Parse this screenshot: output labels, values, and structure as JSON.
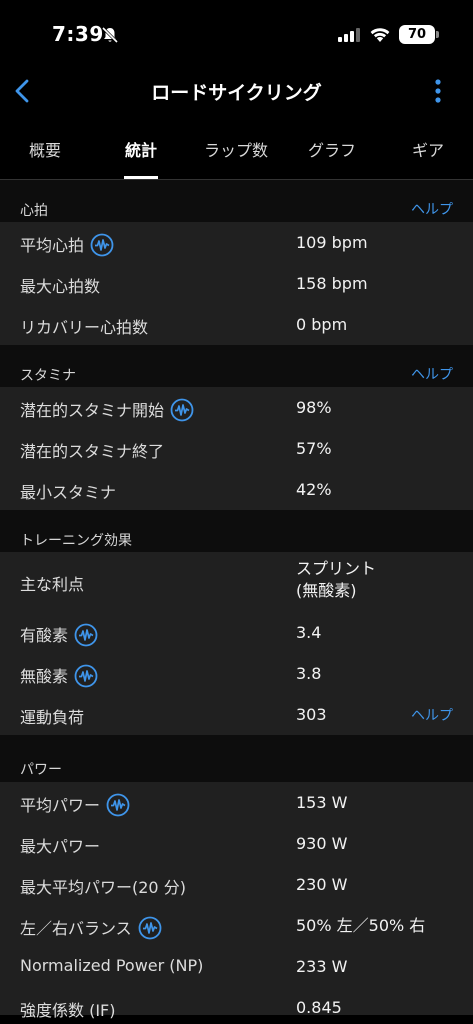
{
  "status": {
    "time": "7:39",
    "battery": "70"
  },
  "nav": {
    "title": "ロードサイクリング"
  },
  "tabs": [
    "概要",
    "統計",
    "ラップ数",
    "グラフ",
    "ギア"
  ],
  "help_label": "ヘルプ",
  "sections": {
    "heart": {
      "title": "心拍",
      "rows": [
        {
          "label": "平均心拍",
          "value": "109 bpm"
        },
        {
          "label": "最大心拍数",
          "value": "158 bpm"
        },
        {
          "label": "リカバリー心拍数",
          "value": "0 bpm"
        }
      ]
    },
    "stamina": {
      "title": "スタミナ",
      "rows": [
        {
          "label": "潜在的スタミナ開始",
          "value": "98%"
        },
        {
          "label": "潜在的スタミナ終了",
          "value": "57%"
        },
        {
          "label": "最小スタミナ",
          "value": "42%"
        }
      ]
    },
    "training": {
      "title": "トレーニング効果",
      "rows": [
        {
          "label": "主な利点",
          "value_line1": "スプリント",
          "value_line2": "(無酸素)"
        },
        {
          "label": "有酸素",
          "value": "3.4"
        },
        {
          "label": "無酸素",
          "value": "3.8"
        },
        {
          "label": "運動負荷",
          "value": "303"
        }
      ]
    },
    "power": {
      "title": "パワー",
      "rows": [
        {
          "label": "平均パワー",
          "value": "153 W"
        },
        {
          "label": "最大パワー",
          "value": "930 W"
        },
        {
          "label": "最大平均パワー(20 分)",
          "value": "230 W"
        },
        {
          "label": "左／右バランス",
          "value": "50% 左／50% 右"
        },
        {
          "label": "Normalized Power (NP)",
          "value": "233 W"
        },
        {
          "label": "強度係数 (IF)",
          "value": "0.845"
        }
      ]
    }
  },
  "colors": {
    "accent": "#3f95ea",
    "row_bg": "#202020",
    "header_bg": "#0d0d0d"
  }
}
